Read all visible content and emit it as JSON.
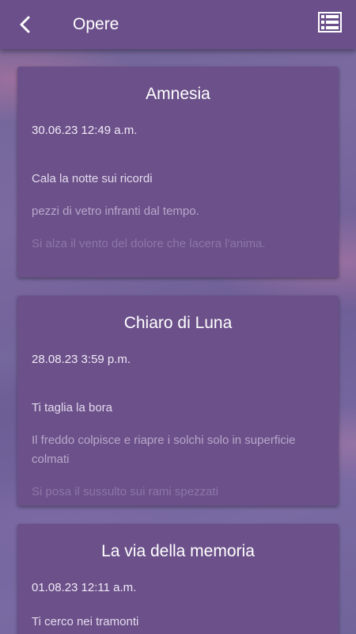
{
  "appbar": {
    "title": "Opere",
    "back_icon": "chevron-left-icon",
    "list_icon": "list-view-icon"
  },
  "colors": {
    "appbar": "#6b4f8a",
    "card": "#6b5089",
    "text": "#ffffff"
  },
  "works": [
    {
      "title": "Amnesia",
      "date": "30.06.23 12:49 a.m.",
      "lines": [
        "Cala la notte sui ricordi",
        "pezzi di vetro infranti dal tempo.",
        "Si alza il vento del dolore che lacera l'anima."
      ]
    },
    {
      "title": "Chiaro di Luna",
      "date": "28.08.23 3:59 p.m.",
      "lines": [
        "Ti taglia la bora",
        "Il freddo colpisce e riapre i solchi solo in superficie colmati",
        "Si posa il sussulto sui rami spezzati"
      ]
    },
    {
      "title": "La via della memoria",
      "date": "01.08.23 12:11 a.m.",
      "lines": [
        "Ti cerco nei tramonti"
      ]
    }
  ]
}
